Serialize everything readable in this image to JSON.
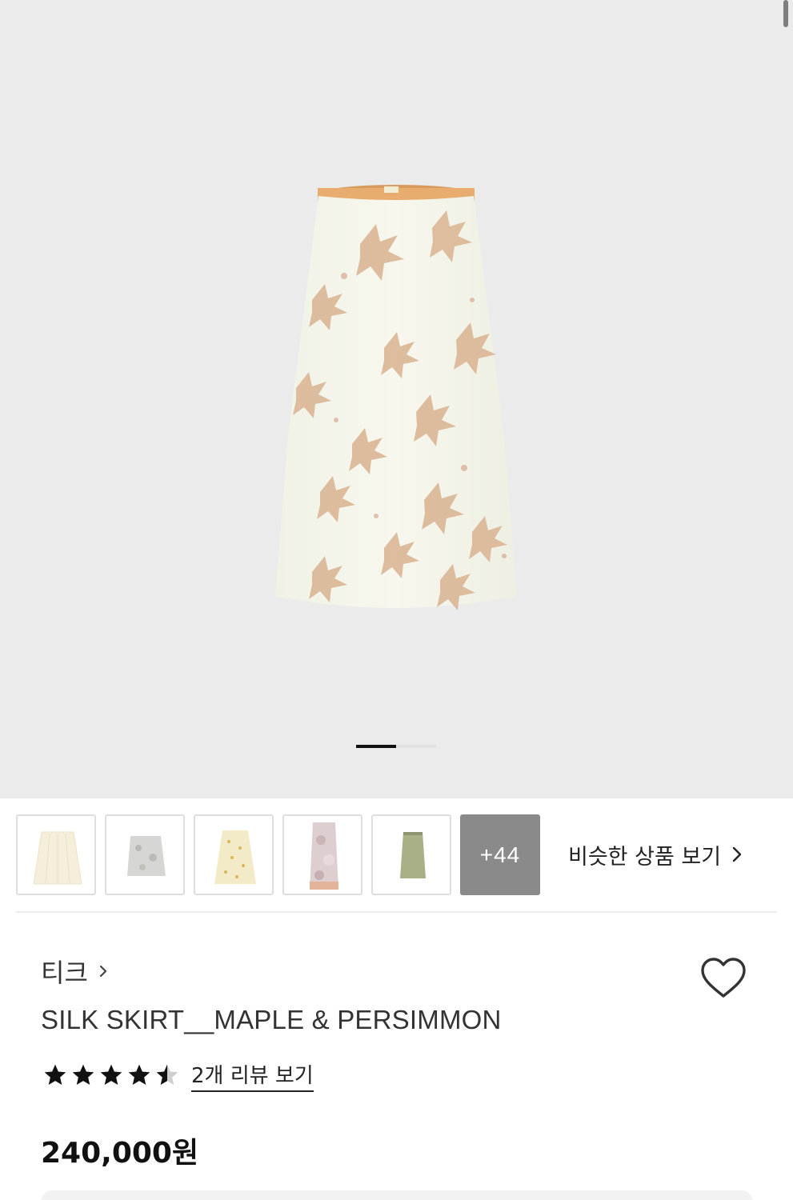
{
  "hero": {
    "image_alt": "silk skirt maple print",
    "pager": {
      "count": 2,
      "active_index": 0
    }
  },
  "thumbnails": {
    "items": [
      {
        "name": "cream-pleated-skirt",
        "fill": "#f4eedb"
      },
      {
        "name": "grey-floral-skirt",
        "fill": "#cfcfcf"
      },
      {
        "name": "yellow-dot-skirt",
        "fill": "#efe3b5"
      },
      {
        "name": "pink-pattern-skirt",
        "fill": "#d9c7c9"
      },
      {
        "name": "olive-green-skirt",
        "fill": "#a8ae85"
      }
    ],
    "more_label": "+44",
    "similar_label": "비슷한 상품 보기"
  },
  "product": {
    "brand": "티크",
    "title": "SILK SKIRT__MAPLE & PERSIMMON",
    "rating": 4.5,
    "review_link": "2개 리뷰 보기",
    "price": "240,000원"
  },
  "colors": {
    "background": "#ebebeb",
    "accent": "#111111",
    "muted": "#8a8a8a"
  }
}
